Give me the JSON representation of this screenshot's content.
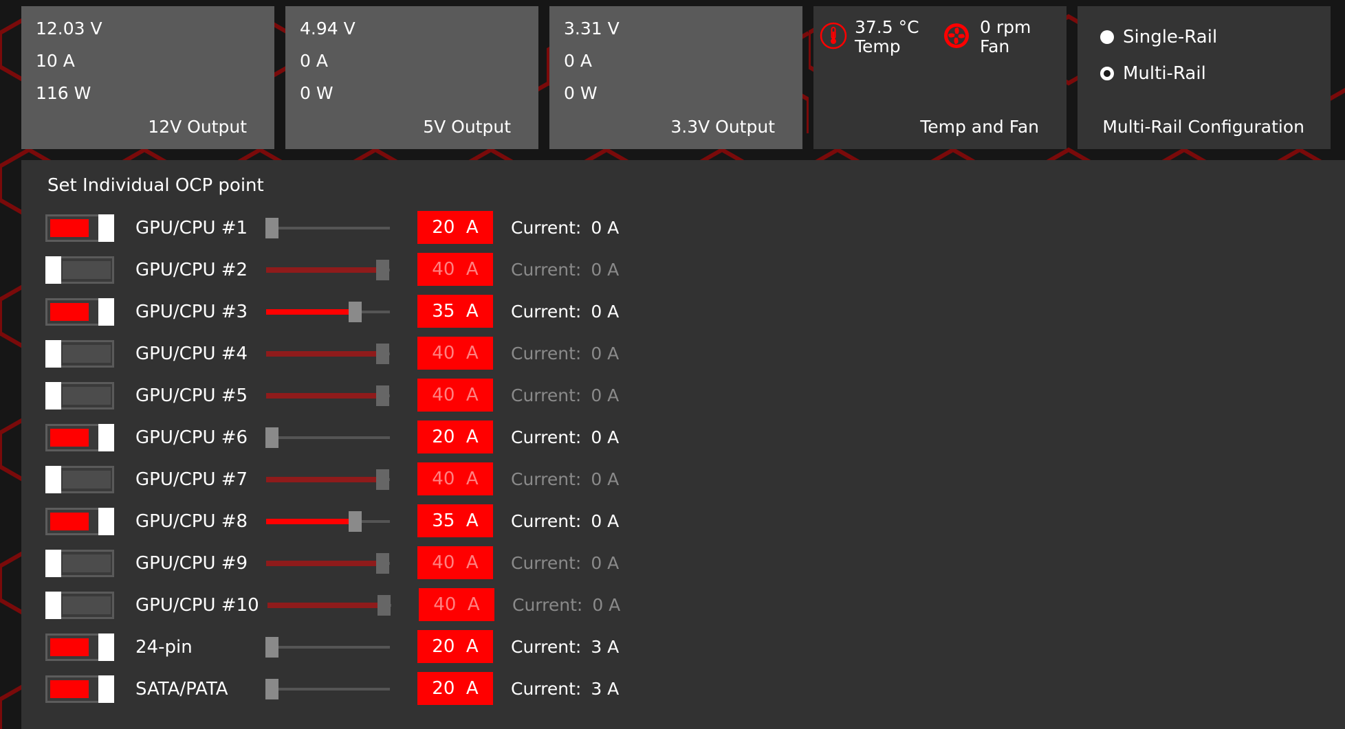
{
  "colors": {
    "accent": "#ff0000",
    "tile": "#5a5a5a",
    "panel": "#323232",
    "background": "#161616"
  },
  "outputs": [
    {
      "voltage": "12.03 V",
      "current": "10 A",
      "power": "116 W",
      "label": "12V Output"
    },
    {
      "voltage": "4.94 V",
      "current": "0 A",
      "power": "0 W",
      "label": "5V Output"
    },
    {
      "voltage": "3.31 V",
      "current": "0 A",
      "power": "0 W",
      "label": "3.3V Output"
    }
  ],
  "temp_fan": {
    "temp_value": "37.5 °C",
    "temp_label": "Temp",
    "temp_icon": "thermometer-icon",
    "fan_value": "0 rpm",
    "fan_label": "Fan",
    "fan_icon": "fan-icon",
    "label": "Temp and Fan"
  },
  "rail_config": {
    "options": [
      {
        "label": "Single-Rail",
        "selected": false
      },
      {
        "label": "Multi-Rail",
        "selected": true
      }
    ],
    "label": "Multi-Rail Configuration"
  },
  "ocp": {
    "title": "Set Individual OCP point",
    "current_label": "Current:",
    "rows": [
      {
        "name": "GPU/CPU #1",
        "enabled": true,
        "value": "20",
        "unit": "A",
        "current": "0 A",
        "level": 0
      },
      {
        "name": "GPU/CPU #2",
        "enabled": false,
        "value": "40",
        "unit": "A",
        "current": "0 A",
        "level": 1
      },
      {
        "name": "GPU/CPU #3",
        "enabled": true,
        "value": "35",
        "unit": "A",
        "current": "0 A",
        "level": 0.75
      },
      {
        "name": "GPU/CPU #4",
        "enabled": false,
        "value": "40",
        "unit": "A",
        "current": "0 A",
        "level": 1
      },
      {
        "name": "GPU/CPU #5",
        "enabled": false,
        "value": "40",
        "unit": "A",
        "current": "0 A",
        "level": 1
      },
      {
        "name": "GPU/CPU #6",
        "enabled": true,
        "value": "20",
        "unit": "A",
        "current": "0 A",
        "level": 0
      },
      {
        "name": "GPU/CPU #7",
        "enabled": false,
        "value": "40",
        "unit": "A",
        "current": "0 A",
        "level": 1
      },
      {
        "name": "GPU/CPU #8",
        "enabled": true,
        "value": "35",
        "unit": "A",
        "current": "0 A",
        "level": 0.75
      },
      {
        "name": "GPU/CPU #9",
        "enabled": false,
        "value": "40",
        "unit": "A",
        "current": "0 A",
        "level": 1
      },
      {
        "name": "GPU/CPU #10",
        "enabled": false,
        "value": "40",
        "unit": "A",
        "current": "0 A",
        "level": 1
      },
      {
        "name": "24-pin",
        "enabled": true,
        "value": "20",
        "unit": "A",
        "current": "3 A",
        "level": 0
      },
      {
        "name": "SATA/PATA",
        "enabled": true,
        "value": "20",
        "unit": "A",
        "current": "3 A",
        "level": 0
      }
    ]
  }
}
